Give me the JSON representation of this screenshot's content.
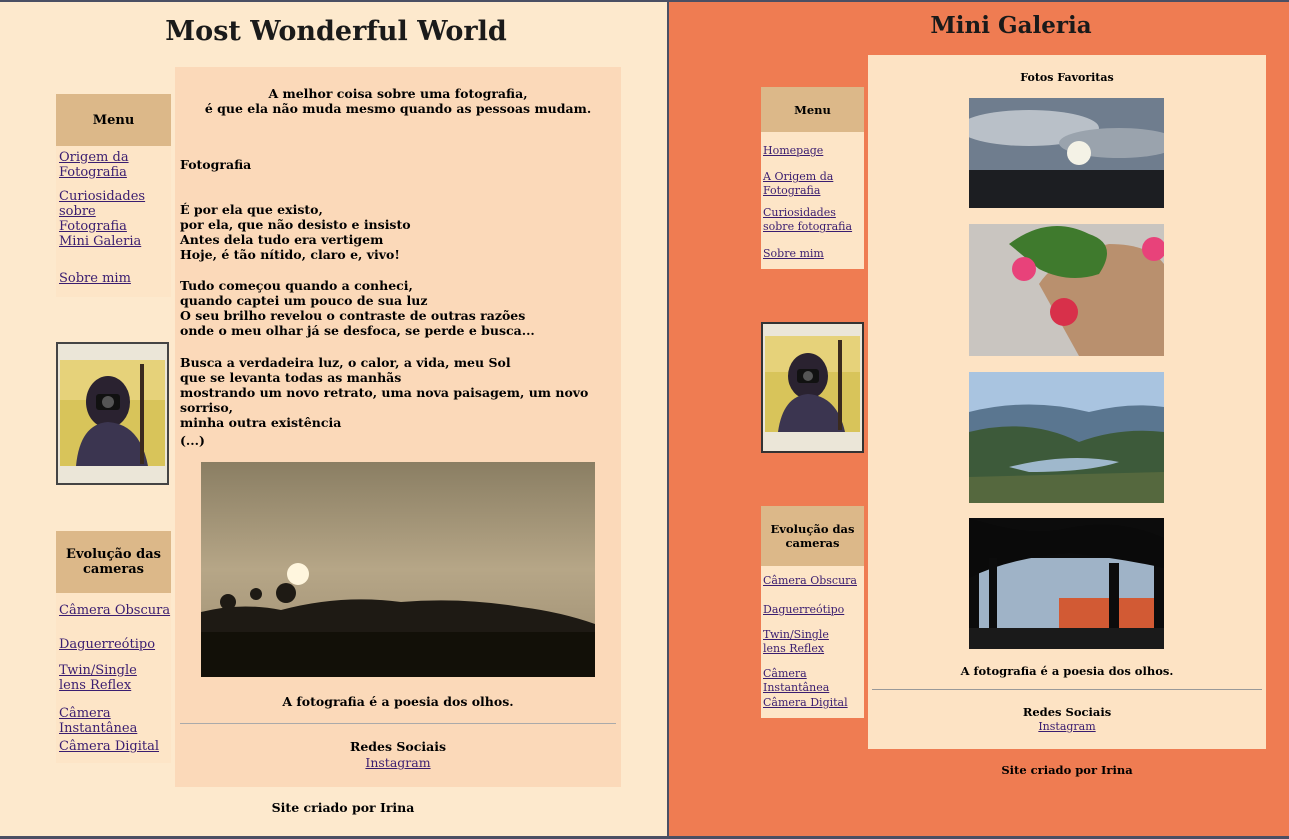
{
  "left_page": {
    "title": "Most Wonderful World",
    "menu": {
      "heading": "Menu",
      "items": [
        "Origem da Fotografia",
        "Curiosidades sobre Fotografia",
        "Mini Galeria",
        "Sobre mim"
      ]
    },
    "cameras": {
      "heading": "Evolução das cameras",
      "items": [
        "Câmera Obscura",
        "Daguerreótipo",
        "Twin/Single lens Reflex",
        "Câmera Instantânea",
        "Câmera Digital"
      ]
    },
    "main": {
      "quote_line1": "A melhor coisa sobre uma fotografia,",
      "quote_line2": "é que ela não muda mesmo quando as pessoas mudam.",
      "subtitle": "Fotografia",
      "stanza1": "É por ela que existo,\npor ela, que não desisto e insisto\nAntes dela tudo era vertigem\nHoje, é tão nítido, claro e, vivo!",
      "stanza2": "Tudo começou quando a conheci,\nquando captei um pouco de sua luz\nO seu brilho revelou o contraste de outras razões\nonde o meu olhar já se desfoca, se perde e busca...",
      "stanza3": "Busca a verdadeira luz, o calor, a vida, meu Sol\nque se levanta todas as manhãs\nmostrando um novo retrato, uma nova paisagem, um novo sorriso,\nminha outra existência",
      "ellipsis": "(...)",
      "caption": "A fotografia é a poesia dos olhos.",
      "social_heading": "Redes Sociais",
      "social_link": "Instagram"
    },
    "footer": "Site criado por Irina"
  },
  "right_page": {
    "title": "Mini Galeria",
    "menu": {
      "heading": "Menu",
      "items": [
        "Homepage",
        "A Origem da Fotografia",
        "Curiosidades sobre fotografia",
        "Sobre mim"
      ]
    },
    "cameras": {
      "heading": "Evolução das cameras",
      "items": [
        "Câmera Obscura",
        "Daguerreótipo",
        "Twin/Single lens Reflex",
        "Câmera Instantânea",
        "Câmera Digital"
      ]
    },
    "gallery": {
      "heading": "Fotos Favoritas",
      "photos": [
        "cloudy-sunset-photo",
        "flowers-pot-photo",
        "river-valley-photo",
        "tree-terrace-photo"
      ],
      "caption": "A fotografia é a poesia dos olhos.",
      "social_heading": "Redes Sociais",
      "social_link": "Instagram"
    },
    "footer": "Site criado por Irina"
  },
  "colors": {
    "left_background": "#fde9cd",
    "right_background": "#ef7c52",
    "sidebar_heading": "#dcb889",
    "link": "#3a1d70"
  }
}
